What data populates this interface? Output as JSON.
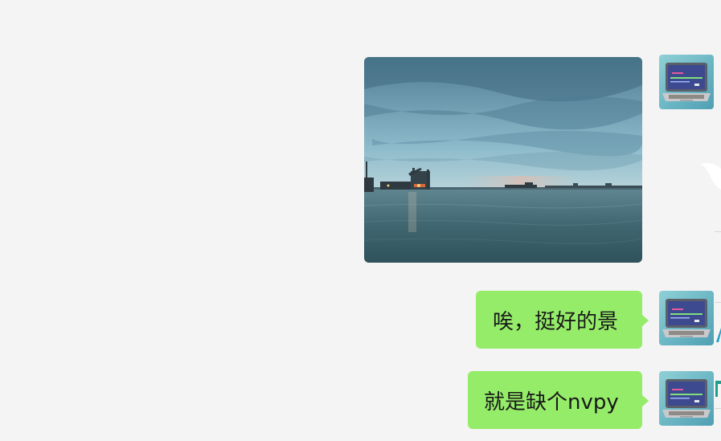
{
  "chat": {
    "messages": [
      {
        "type": "image",
        "sender": "self",
        "avatar_icon": "laptop-icon",
        "image_subject": "harbor-seascape"
      },
      {
        "type": "text",
        "sender": "self",
        "avatar_icon": "laptop-icon",
        "text": "唉，挺好的景"
      },
      {
        "type": "text",
        "sender": "self",
        "avatar_icon": "laptop-icon",
        "text": "就是缺个nvpy"
      }
    ]
  },
  "colors": {
    "background": "#f4f4f4",
    "self_bubble": "#95ec69",
    "text": "#191919"
  }
}
